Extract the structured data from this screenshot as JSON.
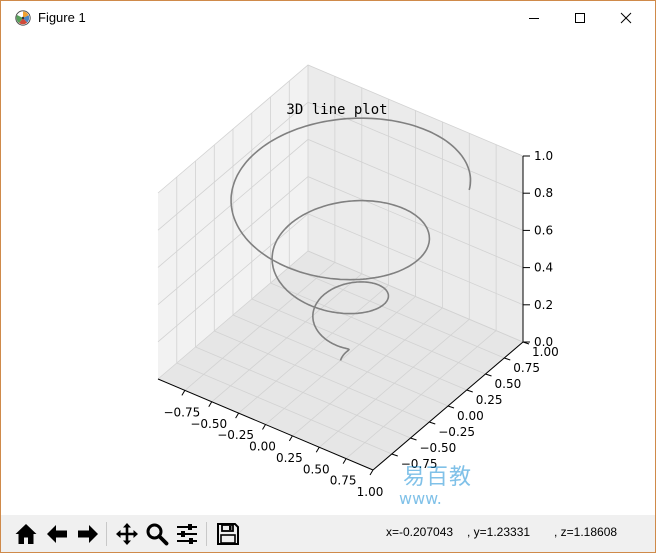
{
  "window": {
    "title": "Figure 1",
    "controls": {
      "minimize_icon": "minimize-icon",
      "maximize_icon": "maximize-icon",
      "close_icon": "close-icon"
    }
  },
  "chart_data": {
    "type": "line",
    "projection": "3d",
    "title": "3D line plot",
    "x_ticks": [
      "−0.75",
      "−0.50",
      "−0.25",
      "0.00",
      "0.25",
      "0.50",
      "0.75",
      "1.00"
    ],
    "y_ticks": [
      "−0.75",
      "−0.50",
      "−0.25",
      "0.00",
      "0.25",
      "0.50",
      "0.75",
      "1.00"
    ],
    "z_ticks": [
      "0.0",
      "0.2",
      "0.4",
      "0.6",
      "0.8",
      "1.0"
    ],
    "xlim": [
      -1,
      1
    ],
    "ylim": [
      -1,
      1
    ],
    "zlim": [
      0,
      1
    ],
    "grid": true,
    "series": [
      {
        "description": "spiral: x = z*sin(20z), y = z*cos(20z), z in [0,1]",
        "z_range": [
          0,
          1
        ],
        "angular_frequency": 20,
        "color": "#808080"
      }
    ]
  },
  "toolbar": {
    "buttons": [
      {
        "name": "home-button",
        "icon": "home-icon"
      },
      {
        "name": "back-button",
        "icon": "left-arrow-icon"
      },
      {
        "name": "forward-button",
        "icon": "right-arrow-icon"
      },
      {
        "name": "pan-button",
        "icon": "move-icon"
      },
      {
        "name": "zoom-button",
        "icon": "magnifier-icon"
      },
      {
        "name": "configure-subplots-button",
        "icon": "sliders-icon"
      },
      {
        "name": "save-button",
        "icon": "floppy-disk-icon"
      }
    ],
    "coords": {
      "x": "x=-0.207043",
      "y": ", y=1.23331",
      "z": ", z=1.18608"
    }
  },
  "watermark": {
    "main": "易百教",
    "sub": "www."
  },
  "colors": {
    "line": "#808080",
    "pane_left": "#f2f2f2",
    "pane_right": "#ebebeb",
    "pane_floor": "#e6e6e6",
    "grid": "#d2d2d2",
    "window_border": "#cf8a4a",
    "toolbar_bg": "#f0f0f0"
  }
}
